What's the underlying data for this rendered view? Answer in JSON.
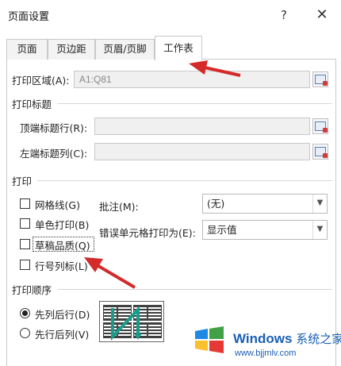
{
  "window": {
    "title": "页面设置",
    "help_label": "?",
    "close_label": "✕"
  },
  "tabs": [
    {
      "label": "页面"
    },
    {
      "label": "页边距"
    },
    {
      "label": "页眉/页脚"
    },
    {
      "label": "工作表",
      "active": true
    }
  ],
  "print_area": {
    "label": "打印区域(A):",
    "value": "A1:Q81"
  },
  "print_titles": {
    "section_label": "打印标题",
    "top_rows_label": "顶端标题行(R):",
    "top_rows_value": "",
    "left_cols_label": "左端标题列(C):",
    "left_cols_value": ""
  },
  "print": {
    "section_label": "打印",
    "gridlines_label": "网格线(G)",
    "gridlines_checked": false,
    "bw_label": "单色打印(B)",
    "bw_checked": false,
    "draft_label": "草稿品质(Q)",
    "draft_checked": false,
    "headings_label": "行号列标(L)",
    "headings_checked": false,
    "comments_label": "批注(M):",
    "comments_value": "(无)",
    "errors_label": "错误单元格打印为(E):",
    "errors_value": "显示值"
  },
  "page_order": {
    "section_label": "打印顺序",
    "down_then_over_label": "先列后行(D)",
    "over_then_down_label": "先行后列(V)",
    "selected": "down_then_over"
  },
  "watermark": {
    "brand": "Windows",
    "brand_cn": "系统之家",
    "url": "www.bjjmlv.com"
  },
  "colors": {
    "annotation_arrow": "#d42a2a",
    "watermark": "#1a5fb4"
  }
}
